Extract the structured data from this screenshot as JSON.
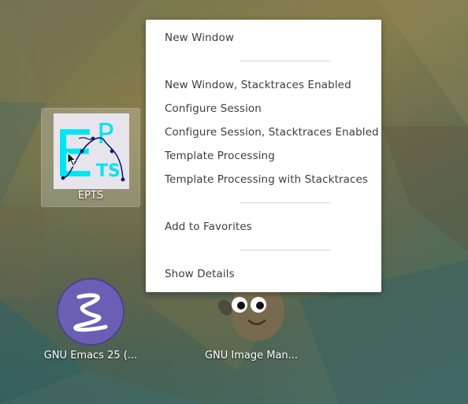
{
  "desktop": {
    "icons": [
      {
        "label": "EPTS",
        "icon": "epts-app-icon",
        "logo_letters": {
          "e": "E",
          "p": "P",
          "ts": "TS"
        }
      },
      {
        "label": "GNU Emacs 25 (...",
        "icon": "emacs-app-icon"
      },
      {
        "label": "GNU Image Man...",
        "icon": "gimp-app-icon"
      }
    ]
  },
  "context_menu": {
    "items": [
      {
        "label": "New Window"
      },
      {
        "label": "New Window, Stacktraces Enabled"
      },
      {
        "label": "Configure Session"
      },
      {
        "label": "Configure Session, Stacktraces Enabled"
      },
      {
        "label": "Template Processing"
      },
      {
        "label": "Template Processing with Stacktraces"
      },
      {
        "label": "Add to Favorites"
      },
      {
        "label": "Show Details"
      }
    ]
  },
  "colors": {
    "epts_letters": "#00e5f0",
    "epts_curve": "#0d1b6e",
    "emacs_purple": "#6a5fb5",
    "menu_text": "#3d3d3d"
  }
}
